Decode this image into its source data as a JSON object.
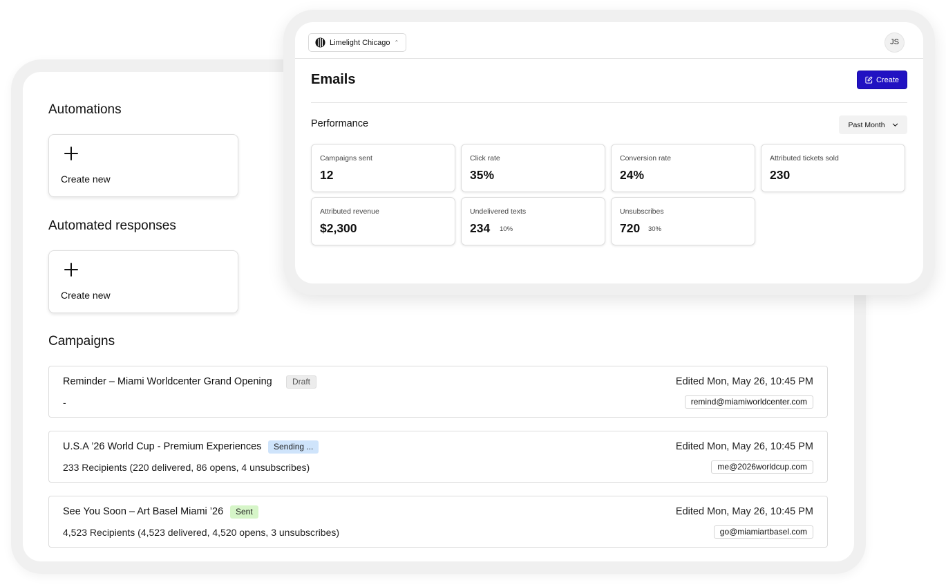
{
  "automations": {
    "title": "Automations",
    "create_label": "Create new"
  },
  "automated_responses": {
    "title": "Automated responses",
    "create_label": "Create new"
  },
  "campaigns": {
    "title": "Campaigns",
    "items": [
      {
        "title": "Reminder – Miami Worldcenter Grand Opening",
        "status": "Draft",
        "summary": "-",
        "edited": "Edited Mon, May 26, 10:45 PM",
        "email": "remind@miamiworldcenter.com"
      },
      {
        "title": "U.S.A ’26 World Cup - Premium Experiences",
        "status": "Sending ...",
        "summary": "233 Recipients (220 delivered, 86 opens, 4 unsubscribes)",
        "edited": "Edited Mon, May 26, 10:45 PM",
        "email": "me@2026worldcup.com"
      },
      {
        "title": "See You Soon – Art Basel Miami ’26",
        "status": "Sent",
        "summary": "4,523 Recipients (4,523 delivered, 4,520 opens, 3 unsubscribes)",
        "edited": "Edited Mon, May 26, 10:45 PM",
        "email": "go@miamiartbasel.com"
      }
    ]
  },
  "header": {
    "org_name": "Limelight Chicago",
    "org_icon": "venue-logo-icon",
    "caret_icon": "chevron-up-down-icon",
    "avatar_initials": "JS"
  },
  "emails": {
    "title": "Emails",
    "create_label": "Create",
    "create_icon": "edit-icon",
    "accent_color": "#2112c2"
  },
  "performance": {
    "title": "Performance",
    "range": "Past Month",
    "metrics": [
      {
        "label": "Campaigns sent",
        "value": "12"
      },
      {
        "label": "Click rate",
        "value": "35%"
      },
      {
        "label": "Conversion rate",
        "value": "24%"
      },
      {
        "label": "Attributed tickets sold",
        "value": "230"
      },
      {
        "label": "Attributed revenue",
        "value": "$2,300"
      },
      {
        "label": "Undelivered texts",
        "value": "234",
        "percent": "10%"
      },
      {
        "label": "Unsubscribes",
        "value": "720",
        "percent": "30%"
      }
    ]
  },
  "badge_colors": {
    "draft": "#ececec",
    "sending": "#cfe4fb",
    "sent": "#d6f5c8"
  }
}
